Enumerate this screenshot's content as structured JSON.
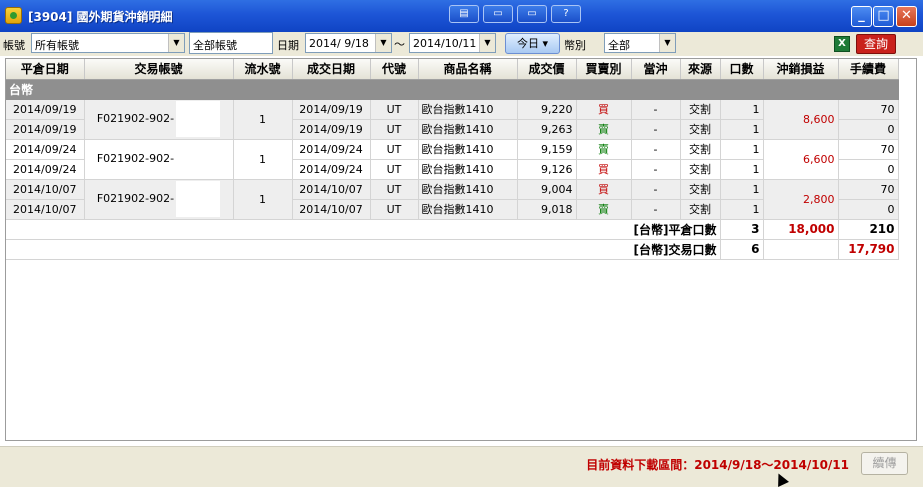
{
  "window": {
    "title": "[3904] 國外期貨沖銷明細",
    "tool_buttons": [
      "▤",
      "▭",
      "▭",
      "?"
    ],
    "minimize": "_",
    "maximize": "□",
    "close": "✕"
  },
  "toolbar": {
    "account_label": "帳號",
    "account_value": "所有帳號",
    "account_textbox": "全部帳號",
    "date_label": "日期",
    "date_from": "2014/ 9/18",
    "date_sep": "～",
    "date_to": "2014/10/11",
    "today_button": "今日 ▾",
    "currency_label": "幣別",
    "currency_value": "全部",
    "excel_icon": "X",
    "query_button": "查詢"
  },
  "table": {
    "headers": [
      "平倉日期",
      "交易帳號",
      "流水號",
      "成交日期",
      "代號",
      "商品名稱",
      "成交價",
      "買賣別",
      "當沖",
      "來源",
      "口數",
      "沖銷損益",
      "手續費"
    ],
    "group_label": "台幣",
    "trades": [
      {
        "account": "F021902-902-",
        "serial": "1",
        "pnl": "8,600",
        "rows": [
          {
            "close_date": "2014/09/19",
            "trade_date": "2014/09/19",
            "code": "UT",
            "product": "歐台指數1410",
            "price": "9,220",
            "side": "買",
            "side_type": "buy",
            "daytrade": "-",
            "source": "交割",
            "lots": "1",
            "fee": "70"
          },
          {
            "close_date": "2014/09/19",
            "trade_date": "2014/09/19",
            "code": "UT",
            "product": "歐台指數1410",
            "price": "9,263",
            "side": "賣",
            "side_type": "sell",
            "daytrade": "-",
            "source": "交割",
            "lots": "1",
            "fee": "0"
          }
        ]
      },
      {
        "account": "F021902-902-",
        "serial": "1",
        "pnl": "6,600",
        "rows": [
          {
            "close_date": "2014/09/24",
            "trade_date": "2014/09/24",
            "code": "UT",
            "product": "歐台指數1410",
            "price": "9,159",
            "side": "賣",
            "side_type": "sell",
            "daytrade": "-",
            "source": "交割",
            "lots": "1",
            "fee": "70"
          },
          {
            "close_date": "2014/09/24",
            "trade_date": "2014/09/24",
            "code": "UT",
            "product": "歐台指數1410",
            "price": "9,126",
            "side": "買",
            "side_type": "buy",
            "daytrade": "-",
            "source": "交割",
            "lots": "1",
            "fee": "0"
          }
        ]
      },
      {
        "account": "F021902-902-",
        "serial": "1",
        "pnl": "2,800",
        "rows": [
          {
            "close_date": "2014/10/07",
            "trade_date": "2014/10/07",
            "code": "UT",
            "product": "歐台指數1410",
            "price": "9,004",
            "side": "買",
            "side_type": "buy",
            "daytrade": "-",
            "source": "交割",
            "lots": "1",
            "fee": "70"
          },
          {
            "close_date": "2014/10/07",
            "trade_date": "2014/10/07",
            "code": "UT",
            "product": "歐台指數1410",
            "price": "9,018",
            "side": "賣",
            "side_type": "sell",
            "daytrade": "-",
            "source": "交割",
            "lots": "1",
            "fee": "0"
          }
        ]
      }
    ],
    "summary": [
      {
        "label": "[台幣]平倉口數",
        "lots": "3",
        "pnl": "18,000",
        "fee": "210"
      },
      {
        "label": "[台幣]交易口數",
        "lots": "6",
        "pnl": "",
        "fee": "17,790"
      }
    ]
  },
  "status": {
    "message": "目前資料下載區間：2014/9/18～2014/10/11",
    "continue_button": "續傳"
  },
  "colors": {
    "buy": "#c00000",
    "sell": "#007a00",
    "query_button": "#c9211b",
    "title_bar": "#1d55d6"
  }
}
